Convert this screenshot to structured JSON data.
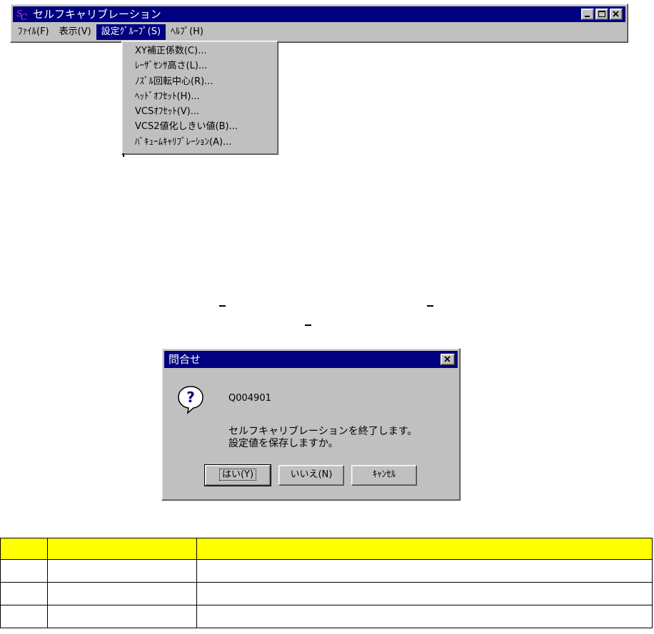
{
  "window": {
    "title": "セルフキャリブレーション",
    "app_icon": "sc-logo-icon",
    "title_buttons": [
      "minimize-icon",
      "maximize-icon",
      "close-icon"
    ]
  },
  "menubar": {
    "items": [
      {
        "label": "ﾌｧｲﾙ(F)"
      },
      {
        "label": "表示(V)"
      },
      {
        "label": "設定ｸﾞﾙｰﾌﾟ(S)",
        "active": true
      },
      {
        "label": "ﾍﾙﾌﾟ(H)"
      }
    ]
  },
  "dropdown": {
    "items": [
      {
        "label": "XY補正係数(C)..."
      },
      {
        "label": "ﾚｰｻﾞｾﾝｻ高さ(L)..."
      },
      {
        "label": "ﾉｽﾞﾙ回転中心(R)..."
      },
      {
        "label": "ﾍｯﾄﾞｵﾌｾｯﾄ(H)..."
      },
      {
        "label": "VCSｵﾌｾｯﾄ(V)..."
      },
      {
        "label": "VCS2値化しきい値(B)..."
      },
      {
        "label": "ﾊﾞｷｭｰﾑｷｬﾘﾌﾞﾚｰｼｮﾝ(A)..."
      }
    ]
  },
  "dialog": {
    "title": "問合せ",
    "icon": "question-icon",
    "code": "Q004901",
    "message_line1": "セルフキャリブレーションを終了します。",
    "message_line2": "設定値を保存しますか。",
    "buttons": {
      "yes": "はい(Y)",
      "no": "いいえ(N)",
      "cancel": "ｷｬﾝｾﾙ"
    }
  },
  "colors": {
    "titlebar": "#000080",
    "face": "#c0c0c0",
    "table_header": "#ffff00"
  },
  "table": {
    "headers": [
      "",
      "",
      ""
    ],
    "rows": [
      [
        "",
        "",
        ""
      ],
      [
        "",
        "",
        ""
      ],
      [
        "",
        "",
        ""
      ]
    ]
  }
}
